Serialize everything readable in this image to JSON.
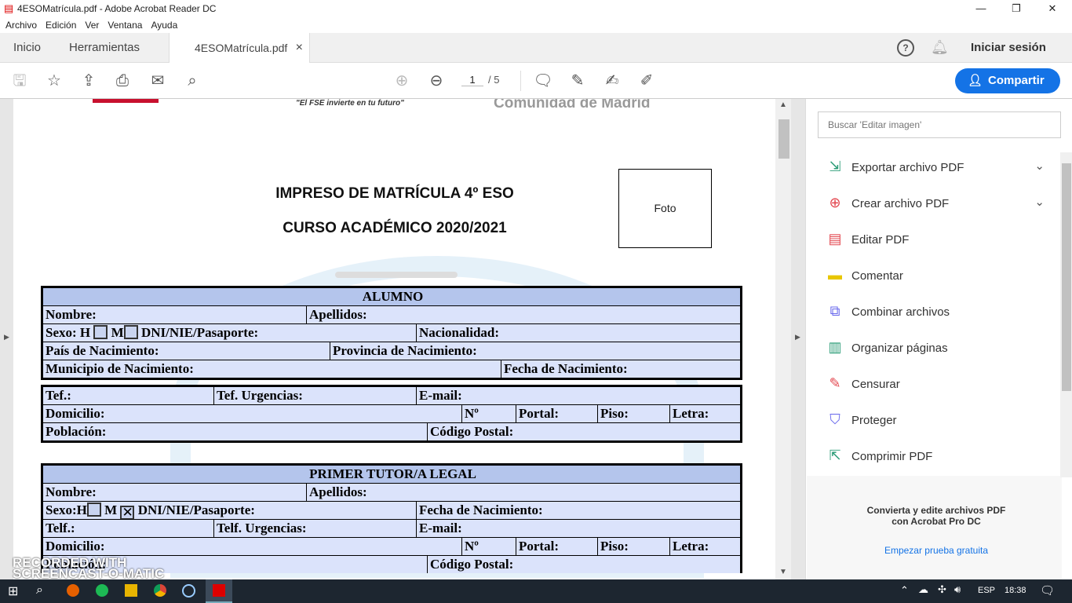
{
  "window": {
    "title": "4ESOMatrícula.pdf - Adobe Acrobat Reader DC",
    "minimize": "—",
    "restore": "❐",
    "close": "✕"
  },
  "menu": [
    "Archivo",
    "Edición",
    "Ver",
    "Ventana",
    "Ayuda"
  ],
  "tabs": {
    "home": "Inicio",
    "tools": "Herramientas",
    "doc": "4ESOMatrícula.pdf",
    "doc_close": "×",
    "signin": "Iniciar sesión"
  },
  "toolbar": {
    "page_current": "1",
    "page_total": "/ 5",
    "share": "Compartir"
  },
  "document": {
    "header_text": "\"El FSE invierte en tu futuro\"",
    "header_org": "Comunidad de Madrid",
    "title1": "IMPRESO DE MATRÍCULA 4º ESO",
    "title2": "CURSO ACADÉMICO 2020/2021",
    "photo": "Foto",
    "alumno": {
      "header": "ALUMNO",
      "nombre": "Nombre:",
      "apellidos": "Apellidos:",
      "sexo": "Sexo: H",
      "m": "M",
      "dni": "DNI/NIE/Pasaporte:",
      "nacionalidad": "Nacionalidad:",
      "pais": "País de Nacimiento:",
      "provincia": "Provincia de Nacimiento:",
      "municipio": "Municipio de Nacimiento:",
      "fecha": "Fecha de Nacimiento:",
      "tel": "Tef.:",
      "tel_urg": "Tef. Urgencias:",
      "email": "E-mail:",
      "domicilio": "Domicilio:",
      "num": "Nº",
      "portal": "Portal:",
      "piso": "Piso:",
      "letra": "Letra:",
      "poblacion": "Población:",
      "cp": "Código Postal:"
    },
    "tutor": {
      "header": "PRIMER TUTOR/A LEGAL",
      "nombre": "Nombre:",
      "apellidos": "Apellidos:",
      "sexo": "Sexo:",
      "h": "H",
      "m": "M",
      "m_mark": "✕",
      "dni": "DNI/NIE/Pasaporte:",
      "fecha": "Fecha de Nacimiento:",
      "tel": "Telf.:",
      "tel_urg": "Telf. Urgencias:",
      "email": "E-mail:",
      "domicilio": "Domicilio:",
      "num": "Nº",
      "portal": "Portal:",
      "piso": "Piso:",
      "letra": "Letra:",
      "poblacion": "Población:",
      "cp": "Código Postal:"
    }
  },
  "panel": {
    "search_placeholder": "Buscar 'Editar imagen'",
    "tools": [
      {
        "label": "Exportar archivo PDF",
        "icon": "export-pdf-icon",
        "color": "#2d9d78"
      },
      {
        "label": "Crear archivo PDF",
        "icon": "create-pdf-icon",
        "color": "#e34850"
      },
      {
        "label": "Editar PDF",
        "icon": "edit-pdf-icon",
        "color": "#e34850"
      },
      {
        "label": "Comentar",
        "icon": "comment-icon",
        "color": "#e8c600"
      },
      {
        "label": "Combinar archivos",
        "icon": "combine-icon",
        "color": "#6767ec"
      },
      {
        "label": "Organizar páginas",
        "icon": "organize-icon",
        "color": "#2d9d78"
      },
      {
        "label": "Censurar",
        "icon": "redact-icon",
        "color": "#e34850"
      },
      {
        "label": "Proteger",
        "icon": "protect-icon",
        "color": "#6767ec"
      },
      {
        "label": "Comprimir PDF",
        "icon": "compress-icon",
        "color": "#2d9d78"
      }
    ],
    "promo": "Convierta y edite archivos PDF con Acrobat Pro DC",
    "trial": "Empezar prueba gratuita"
  },
  "watermark": "RECORDED WITH SCREENCAST-O-MATIC",
  "taskbar": {
    "lang": "ESP",
    "time": "18:38"
  }
}
